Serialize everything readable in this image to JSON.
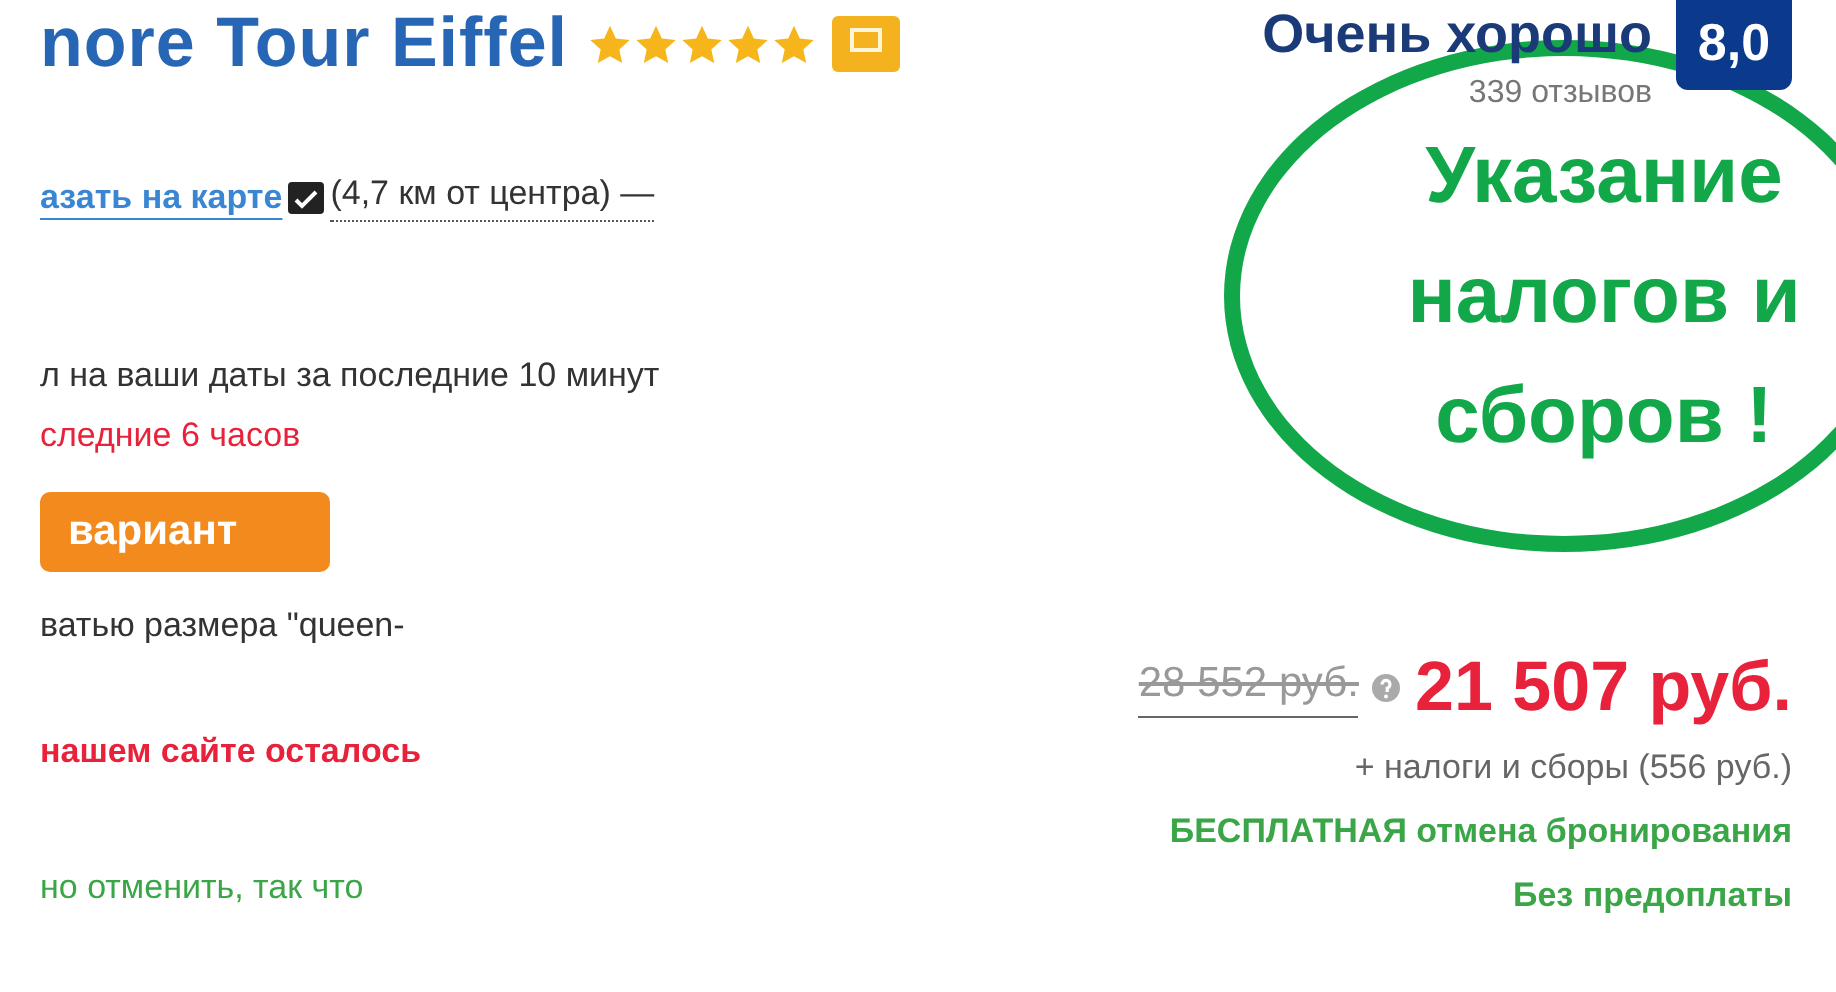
{
  "hotel": {
    "name": "nore Tour Eiffel",
    "stars": 5
  },
  "location": {
    "map_link": "азать на карте",
    "distance": "(4,7 км от центра) —"
  },
  "recent_booking": "л на ваши даты за последние 10 минут",
  "recent_alert": "следние 6 часов",
  "cta_button": "вариант",
  "room_info": "ватью размера \"queen-",
  "scarcity": "нашем сайте осталось",
  "cancellation_note": "но отменить, так что",
  "review": {
    "rating_text": "Очень хорошо",
    "count": "339 отзывов",
    "score": "8,0"
  },
  "price": {
    "original": "28 552 руб.",
    "current": "21 507 руб.",
    "taxes": "+ налоги и сборы (556 руб.)",
    "free_cancellation": "БЕСПЛАТНАЯ отмена бронирования",
    "no_prepayment": "Без предоплаты"
  },
  "annotation": {
    "lines": [
      "Указание",
      "налогов и",
      "сборов !"
    ]
  }
}
